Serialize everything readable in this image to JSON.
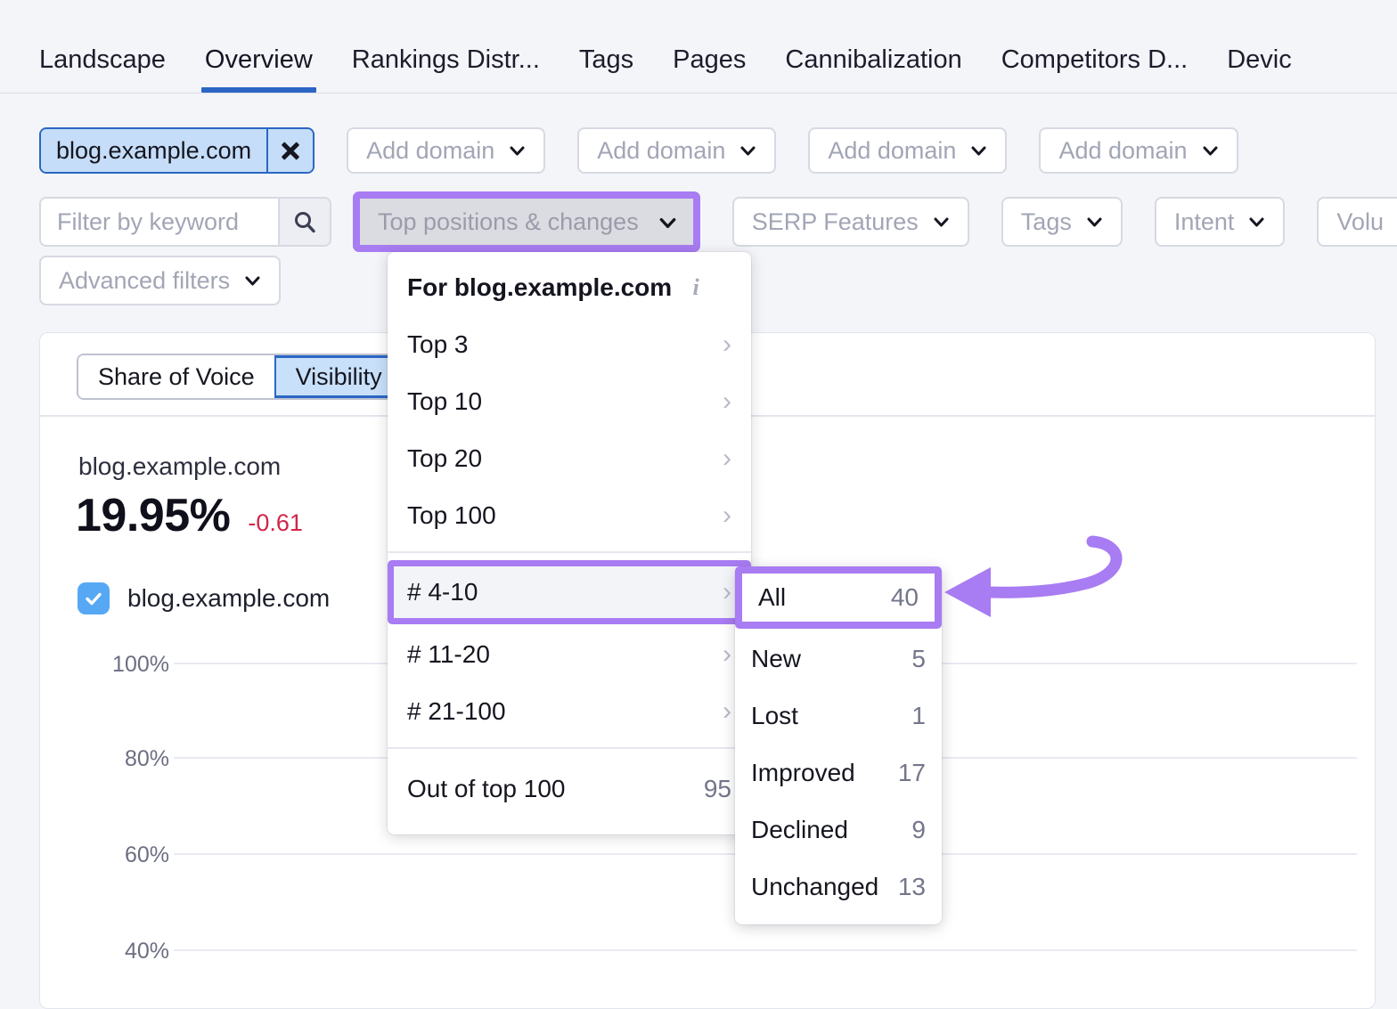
{
  "tabs": [
    {
      "label": "Landscape",
      "active": false
    },
    {
      "label": "Overview",
      "active": true
    },
    {
      "label": "Rankings Distr...",
      "active": false
    },
    {
      "label": "Tags",
      "active": false
    },
    {
      "label": "Pages",
      "active": false
    },
    {
      "label": "Cannibalization",
      "active": false
    },
    {
      "label": "Competitors D...",
      "active": false
    },
    {
      "label": "Devic",
      "active": false
    }
  ],
  "domains": {
    "selected": "blog.example.com",
    "close_icon": "close-icon",
    "add_slots": [
      "Add domain",
      "Add domain",
      "Add domain",
      "Add domain"
    ]
  },
  "filters": {
    "keyword_placeholder": "Filter by keyword",
    "keyword_value": "",
    "search_icon": "search-icon",
    "top_positions": "Top positions & changes",
    "serp_features": "SERP Features",
    "tags": "Tags",
    "intent": "Intent",
    "volume": "Volu",
    "advanced": "Advanced filters"
  },
  "dropdown": {
    "header": "For blog.example.com",
    "info_icon": "info-icon",
    "items": [
      {
        "label": "Top 3",
        "count": "",
        "has_arrow": true,
        "highlighted": false
      },
      {
        "label": "Top 10",
        "count": "",
        "has_arrow": true,
        "highlighted": false
      },
      {
        "label": "Top 20",
        "count": "",
        "has_arrow": true,
        "highlighted": false
      },
      {
        "label": "Top 100",
        "count": "",
        "has_arrow": true,
        "highlighted": false
      },
      {
        "label": "# 4-10",
        "count": "",
        "has_arrow": true,
        "highlighted": true
      },
      {
        "label": "# 11-20",
        "count": "",
        "has_arrow": true,
        "highlighted": false
      },
      {
        "label": "# 21-100",
        "count": "",
        "has_arrow": true,
        "highlighted": false
      }
    ],
    "footer": {
      "label": "Out of top 100",
      "count": "95"
    }
  },
  "submenu": {
    "highlighted": {
      "label": "All",
      "count": "40"
    },
    "items": [
      {
        "label": "New",
        "count": "5"
      },
      {
        "label": "Lost",
        "count": "1"
      },
      {
        "label": "Improved",
        "count": "17"
      },
      {
        "label": "Declined",
        "count": "9"
      },
      {
        "label": "Unchanged",
        "count": "13"
      }
    ]
  },
  "card": {
    "segment": [
      {
        "label": "Share of Voice",
        "active": false
      },
      {
        "label": "Visibility",
        "active": true
      }
    ],
    "metric_domain": "blog.example.com",
    "metric_value": "19.95%",
    "metric_delta": "-0.61",
    "legend_label": "blog.example.com",
    "legend_checked": true
  },
  "chart_data": {
    "type": "line",
    "title": "",
    "xlabel": "",
    "ylabel": "",
    "ylim": [
      40,
      100
    ],
    "grid": true,
    "ytick_labels": [
      "100%",
      "80%",
      "60%",
      "40%"
    ],
    "ytick_values": [
      100,
      80,
      60,
      40
    ],
    "series": [
      {
        "name": "blog.example.com",
        "color": "#56a8f5",
        "values": []
      }
    ]
  },
  "annotations": {
    "highlight_color": "#a87cf2",
    "arrow": "curved-left-arrow"
  }
}
